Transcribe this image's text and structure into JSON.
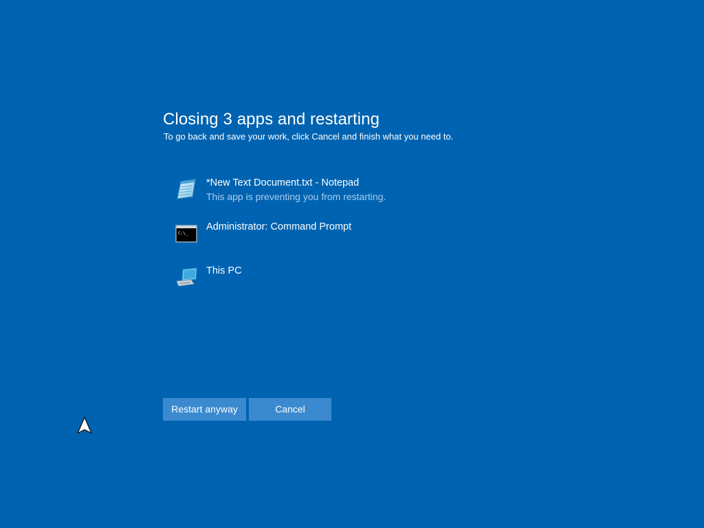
{
  "dialog": {
    "title": "Closing 3 apps and restarting",
    "subtitle": "To go back and save your work, click Cancel and finish what you need to."
  },
  "apps": [
    {
      "name": "*New Text Document.txt - Notepad",
      "status": "This app is preventing you from restarting.",
      "icon": "notepad-icon"
    },
    {
      "name": "Administrator: Command Prompt",
      "status": "",
      "icon": "command-prompt-icon"
    },
    {
      "name": "This PC",
      "status": "",
      "icon": "this-pc-icon"
    }
  ],
  "buttons": {
    "restart_label": "Restart anyway",
    "cancel_label": "Cancel"
  },
  "colors": {
    "background": "#0063b1",
    "button": "#3b8ad0",
    "secondary_text": "#a7cdf0"
  }
}
